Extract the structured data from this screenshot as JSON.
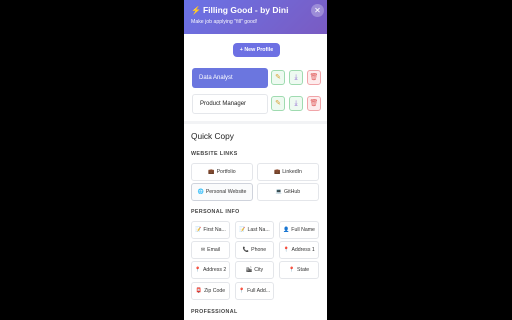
{
  "header": {
    "title": "Filling Good - by Dini",
    "subtitle": "Make job applying \"fill\" good!",
    "close_icon": "close-icon",
    "bolt_icon": "lightning-icon"
  },
  "new_profile": {
    "label": "+ New Profile"
  },
  "profiles": [
    {
      "name": "Data Analyst",
      "active": true
    },
    {
      "name": "Product Manager",
      "active": false
    }
  ],
  "profile_actions": {
    "edit_icon": "pencil-icon",
    "download_icon": "download-icon",
    "delete_icon": "trash-icon"
  },
  "quick_copy": {
    "title": "Quick Copy",
    "website_links": {
      "label": "WEBSITE LINKS",
      "items": [
        {
          "label": "Portfolio",
          "icon": "briefcase-icon"
        },
        {
          "label": "LinkedIn",
          "icon": "briefcase-icon"
        },
        {
          "label": "Personal Website",
          "icon": "globe-icon"
        },
        {
          "label": "GitHub",
          "icon": "computer-icon"
        }
      ]
    },
    "personal_info": {
      "label": "PERSONAL INFO",
      "items": [
        {
          "label": "First Na...",
          "icon": "memo-icon"
        },
        {
          "label": "Last Na...",
          "icon": "memo-icon"
        },
        {
          "label": "Full Name",
          "icon": "person-icon"
        },
        {
          "label": "Email",
          "icon": "email-icon"
        },
        {
          "label": "Phone",
          "icon": "phone-icon"
        },
        {
          "label": "Address 1",
          "icon": "pin-icon"
        },
        {
          "label": "Address 2",
          "icon": "pin-icon"
        },
        {
          "label": "City",
          "icon": "city-icon"
        },
        {
          "label": "State",
          "icon": "pin-icon"
        },
        {
          "label": "Zip Code",
          "icon": "mailbox-icon"
        },
        {
          "label": "Full Add...",
          "icon": "pin-icon"
        }
      ]
    },
    "professional": {
      "label": "PROFESSIONAL"
    }
  },
  "colors": {
    "header_start": "#6a73e6",
    "header_end": "#7a5bc2",
    "accent": "#6d70e3",
    "active_profile": "#6b76df"
  }
}
